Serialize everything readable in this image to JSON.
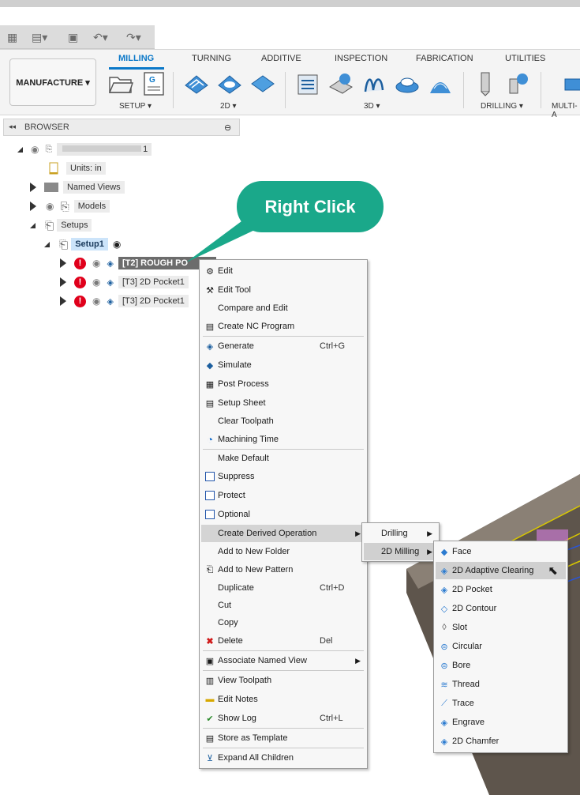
{
  "ribbon": {
    "workspace_label": "MANUFACTURE ▾",
    "tabs": [
      "MILLING",
      "TURNING",
      "ADDITIVE",
      "INSPECTION",
      "FABRICATION",
      "UTILITIES"
    ],
    "groups": [
      "SETUP ▾",
      "2D ▾",
      "3D ▾",
      "DRILLING ▾",
      "MULTI-A"
    ]
  },
  "browser": {
    "title": "BROWSER",
    "root_label": "1",
    "units": "Units: in",
    "named_views": "Named Views",
    "models": "Models",
    "setups": "Setups",
    "setup1": "Setup1",
    "ops": [
      "[T2] ROUGH PO",
      "[T3] 2D Pocket1",
      "[T3] 2D Pocket1"
    ]
  },
  "callout": {
    "text": "Right Click"
  },
  "context_menu": {
    "items": [
      {
        "label": "Edit",
        "icon": "gear-icon"
      },
      {
        "label": "Edit Tool",
        "icon": "tool-icon"
      },
      {
        "label": "Compare and Edit",
        "icon": ""
      },
      {
        "label": "Create NC Program",
        "icon": "nc-program-icon"
      },
      {
        "label": "Generate",
        "shortcut": "Ctrl+G",
        "icon": "generate-icon"
      },
      {
        "label": "Simulate",
        "icon": "simulate-icon"
      },
      {
        "label": "Post Process",
        "icon": "post-process-icon"
      },
      {
        "label": "Setup Sheet",
        "icon": "setup-sheet-icon"
      },
      {
        "label": "Clear Toolpath",
        "icon": ""
      },
      {
        "label": "Machining Time",
        "icon": "machining-time-icon"
      },
      {
        "label": "Make Default",
        "icon": ""
      },
      {
        "label": "Suppress",
        "icon": "checkbox-icon"
      },
      {
        "label": "Protect",
        "icon": "checkbox-icon"
      },
      {
        "label": "Optional",
        "icon": "checkbox-icon"
      },
      {
        "label": "Create Derived Operation",
        "icon": "",
        "submenu": true
      },
      {
        "label": "Add to New Folder",
        "icon": ""
      },
      {
        "label": "Add to New Pattern",
        "icon": "pattern-icon"
      },
      {
        "label": "Duplicate",
        "shortcut": "Ctrl+D",
        "icon": ""
      },
      {
        "label": "Cut",
        "icon": ""
      },
      {
        "label": "Copy",
        "icon": ""
      },
      {
        "label": "Delete",
        "shortcut": "Del",
        "icon": "delete-icon"
      },
      {
        "label": "Associate Named View",
        "icon": "named-view-icon",
        "submenu": true
      },
      {
        "label": "View Toolpath",
        "icon": "view-toolpath-icon"
      },
      {
        "label": "Edit Notes",
        "icon": "notes-icon"
      },
      {
        "label": "Show Log",
        "shortcut": "Ctrl+L",
        "icon": "log-icon"
      },
      {
        "label": "Store as Template",
        "icon": "template-icon"
      },
      {
        "label": "Expand All Children",
        "icon": "expand-icon"
      }
    ]
  },
  "derived_menu": {
    "items": [
      "Drilling",
      "2D Milling"
    ]
  },
  "milling_menu": {
    "items": [
      "Face",
      "2D Adaptive Clearing",
      "2D Pocket",
      "2D Contour",
      "Slot",
      "Circular",
      "Bore",
      "Thread",
      "Trace",
      "Engrave",
      "2D Chamfer"
    ]
  },
  "colors": {
    "accent": "#0b78c8",
    "callout": "#1aa88a",
    "warning": "#e0001b"
  }
}
